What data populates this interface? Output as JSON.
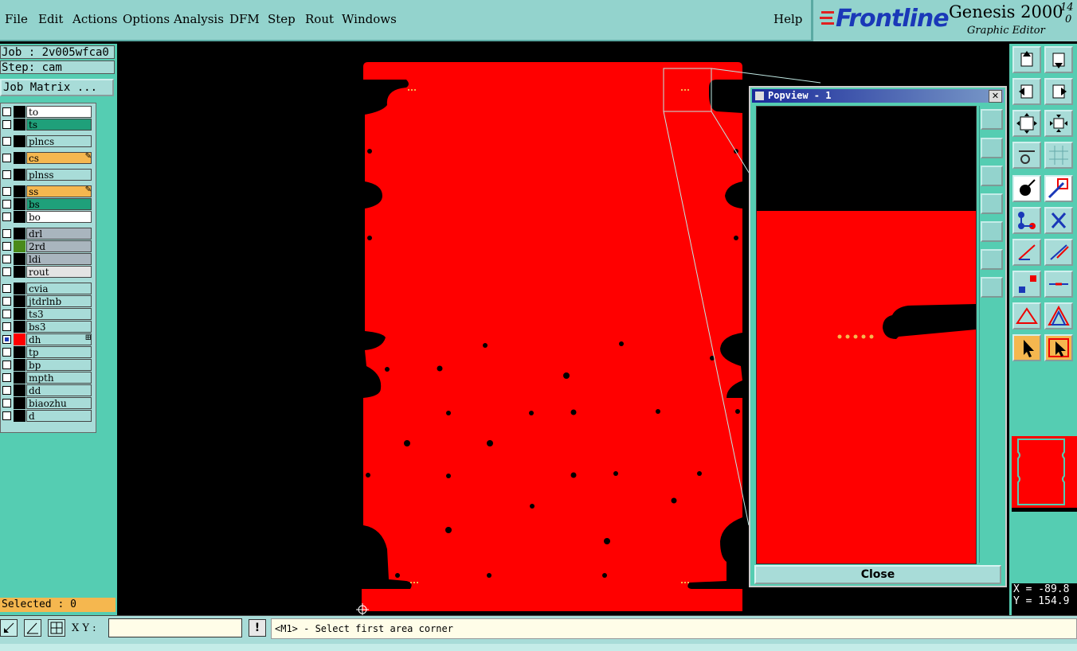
{
  "menu": {
    "file": "File",
    "edit": "Edit",
    "actions": "Actions",
    "options": "Options",
    "analysis": "Analysis",
    "dfm": "DFM",
    "step": "Step",
    "rout": "Rout",
    "windows": "Windows",
    "help": "Help"
  },
  "brand": {
    "company": "Frontline",
    "product": "Genesis 2000",
    "version_top": "14",
    "version_bottom": "0",
    "subtitle": "Graphic Editor"
  },
  "left": {
    "job": "Job : 2v005wfca0",
    "step": "Step: cam",
    "job_matrix": "Job Matrix ...",
    "selected": "Selected : 0"
  },
  "layers": [
    {
      "name": "to",
      "bg": "#ffffff",
      "color": "#000000",
      "flag": ""
    },
    {
      "name": "ts",
      "bg": "#1fa07a",
      "color": "#000000",
      "flag": ""
    },
    {
      "name": "plncs",
      "bg": "#a8dcd8",
      "color": "#000000",
      "flag": ""
    },
    {
      "name": "cs",
      "bg": "#f5b74f",
      "color": "#000000",
      "flag": "✎"
    },
    {
      "name": "plnss",
      "bg": "#a8dcd8",
      "color": "#000000",
      "flag": ""
    },
    {
      "name": "ss",
      "bg": "#f5b74f",
      "color": "#000000",
      "flag": "✎"
    },
    {
      "name": "bs",
      "bg": "#1fa07a",
      "color": "#000000",
      "flag": ""
    },
    {
      "name": "bo",
      "bg": "#ffffff",
      "color": "#000000",
      "flag": ""
    },
    {
      "name": "drl",
      "bg": "#a9b5be",
      "color": "#000000",
      "flag": ""
    },
    {
      "name": "2rd",
      "bg": "#a9b5be",
      "color": "#4a8a1a",
      "flag": ""
    },
    {
      "name": "ldi",
      "bg": "#a9b5be",
      "color": "#000000",
      "flag": ""
    },
    {
      "name": "rout",
      "bg": "#e4e4e4",
      "color": "#000000",
      "flag": ""
    },
    {
      "name": "cvia",
      "bg": "#a8dcd8",
      "color": "#000000",
      "flag": ""
    },
    {
      "name": "jtdrlnb",
      "bg": "#a8dcd8",
      "color": "#000000",
      "flag": ""
    },
    {
      "name": "ts3",
      "bg": "#a8dcd8",
      "color": "#000000",
      "flag": ""
    },
    {
      "name": "bs3",
      "bg": "#a8dcd8",
      "color": "#000000",
      "flag": ""
    },
    {
      "name": "dh",
      "bg": "#a8dcd8",
      "color": "#ff0000",
      "flag": "⊞",
      "checked": true
    },
    {
      "name": "tp",
      "bg": "#a8dcd8",
      "color": "#000000",
      "flag": ""
    },
    {
      "name": "bp",
      "bg": "#a8dcd8",
      "color": "#000000",
      "flag": ""
    },
    {
      "name": "mpth",
      "bg": "#a8dcd8",
      "color": "#000000",
      "flag": ""
    },
    {
      "name": "dd",
      "bg": "#a8dcd8",
      "color": "#000000",
      "flag": ""
    },
    {
      "name": "biaozhu",
      "bg": "#a8dcd8",
      "color": "#000000",
      "flag": ""
    },
    {
      "name": "d",
      "bg": "#a8dcd8",
      "color": "#000000",
      "flag": ""
    }
  ],
  "popview": {
    "title": "Popview - 1",
    "close": "Close"
  },
  "bottom": {
    "xy_label": "X Y :",
    "xy_value": "",
    "warn": "!",
    "status": "<M1> - Select first area corner"
  },
  "coords": {
    "x": "X = -89.8",
    "y": "Y = 154.9"
  },
  "colors": {
    "board": "#ff0000",
    "panel": "#55cdb2",
    "menu_bg": "#93d3cd",
    "brand_blue": "#1a38b8",
    "highlight": "#f5b74f"
  }
}
